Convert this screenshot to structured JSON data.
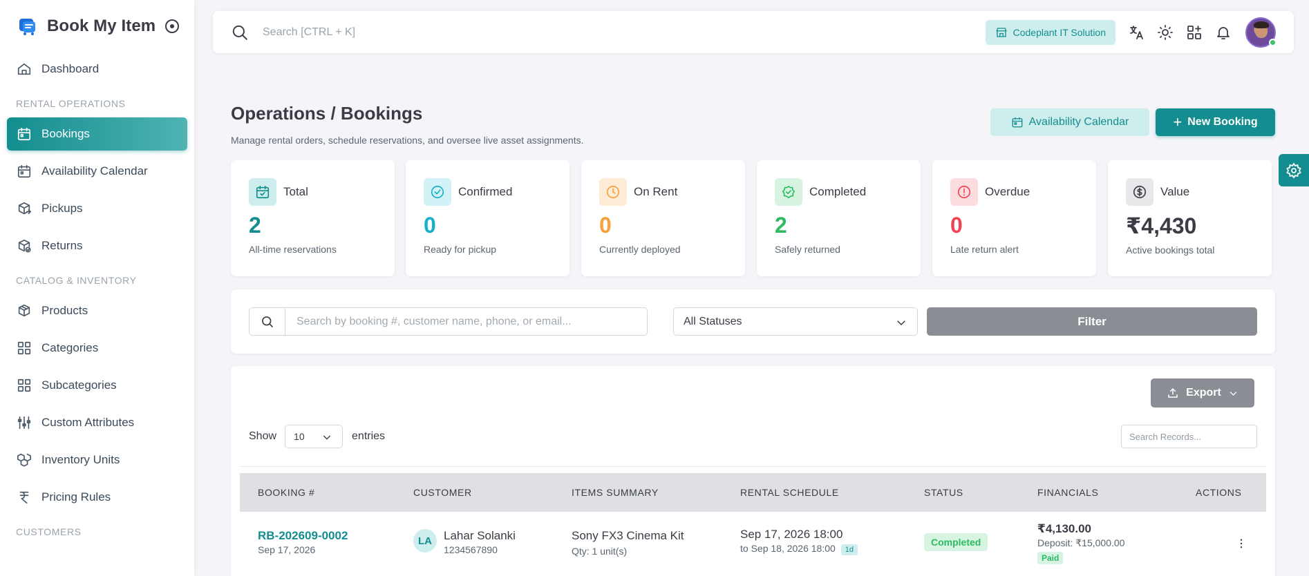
{
  "brand": {
    "name": "Book My Item"
  },
  "sidebar": {
    "items": [
      {
        "type": "item",
        "label": "Dashboard",
        "icon": "home-icon"
      },
      {
        "type": "section",
        "label": "RENTAL OPERATIONS"
      },
      {
        "type": "item",
        "label": "Bookings",
        "icon": "calendar-icon",
        "active": true
      },
      {
        "type": "item",
        "label": "Availability Calendar",
        "icon": "calendar-icon"
      },
      {
        "type": "item",
        "label": "Pickups",
        "icon": "package-out-icon"
      },
      {
        "type": "item",
        "label": "Returns",
        "icon": "package-return-icon"
      },
      {
        "type": "section",
        "label": "CATALOG & INVENTORY"
      },
      {
        "type": "item",
        "label": "Products",
        "icon": "box-icon"
      },
      {
        "type": "item",
        "label": "Categories",
        "icon": "grid-icon"
      },
      {
        "type": "item",
        "label": "Subcategories",
        "icon": "grid-icon"
      },
      {
        "type": "item",
        "label": "Custom Attributes",
        "icon": "sliders-icon"
      },
      {
        "type": "item",
        "label": "Inventory Units",
        "icon": "boxes-icon"
      },
      {
        "type": "item",
        "label": "Pricing Rules",
        "icon": "rupee-icon"
      },
      {
        "type": "section",
        "label": "CUSTOMERS"
      }
    ]
  },
  "navbar": {
    "search_placeholder": "Search [CTRL + K]",
    "company": "Codeplant IT Solution"
  },
  "page": {
    "title_prefix": "Operations / ",
    "title": "Bookings",
    "subtitle": "Manage rental orders, schedule reservations, and oversee live asset assignments.",
    "calendar_button": "Availability Calendar",
    "new_button": "New Booking"
  },
  "stats": [
    {
      "label": "Total",
      "value": "2",
      "desc": "All-time reservations",
      "color": "#138d8f",
      "bg": "#cdeeed",
      "icon": "calendar-check-icon"
    },
    {
      "label": "Confirmed",
      "value": "0",
      "desc": "Ready for pickup",
      "color": "#16b1c9",
      "bg": "#d2f2f7",
      "icon": "check-circle-icon"
    },
    {
      "label": "On Rent",
      "value": "0",
      "desc": "Currently deployed",
      "color": "#f6a13b",
      "bg": "#fdebd6",
      "icon": "clock-icon"
    },
    {
      "label": "Completed",
      "value": "2",
      "desc": "Safely returned",
      "color": "#2dbb61",
      "bg": "#d6f4e1",
      "icon": "badge-check-icon"
    },
    {
      "label": "Overdue",
      "value": "0",
      "desc": "Late return alert",
      "color": "#ee4455",
      "bg": "#fcdcdf",
      "icon": "alert-circle-icon"
    },
    {
      "label": "Value",
      "value": "₹4,430",
      "desc": "Active bookings total",
      "color": "#3a3b45",
      "bg": "#e7e8ea",
      "icon": "currency-coin-icon"
    }
  ],
  "filters": {
    "search_placeholder": "Search by booking #, customer name, phone, or email...",
    "status_selected": "All Statuses",
    "filter_button": "Filter"
  },
  "table": {
    "export_label": "Export",
    "show_label": "Show",
    "entries_value": "10",
    "entries_label": "entries",
    "records_placeholder": "Search Records...",
    "headers": [
      "BOOKING #",
      "CUSTOMER",
      "ITEMS SUMMARY",
      "RENTAL SCHEDULE",
      "STATUS",
      "FINANCIALS",
      "ACTIONS"
    ],
    "rows": [
      {
        "booking_id": "RB-202609-0002",
        "booking_date": "Sep 17, 2026",
        "customer_initials": "LA",
        "customer_name": "Lahar Solanki",
        "customer_phone": "1234567890",
        "item": "Sony FX3 Cinema Kit",
        "qty": "Qty: 1 unit(s)",
        "schedule_start": "Sep 17, 2026 18:00",
        "schedule_end": "to Sep 18, 2026 18:00",
        "duration": "1d",
        "status": "Completed",
        "amount": "₹4,130.00",
        "deposit": "Deposit: ₹15,000.00",
        "payment": "Paid"
      }
    ]
  }
}
